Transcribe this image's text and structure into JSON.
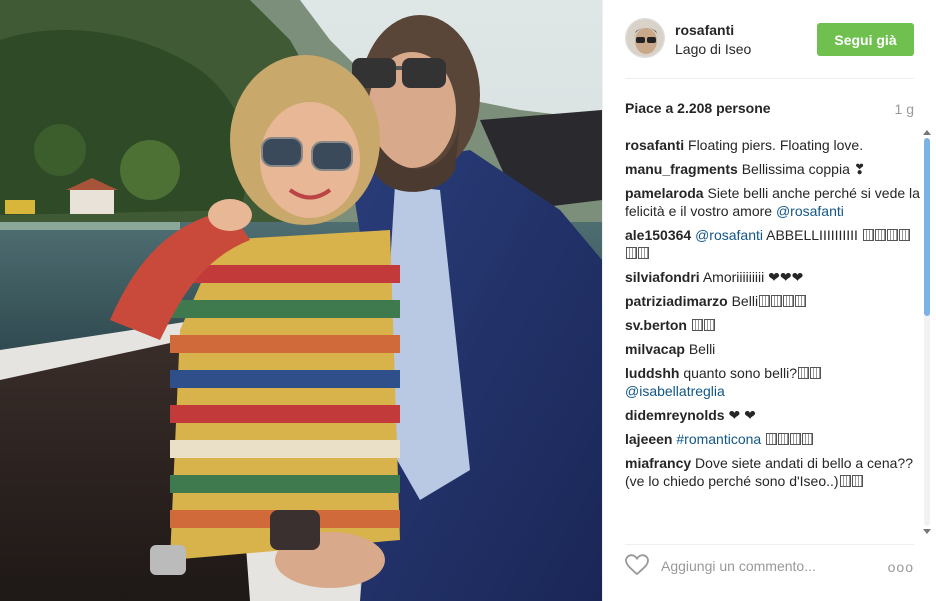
{
  "post": {
    "username": "rosafanti",
    "location": "Lago di Iseo",
    "follow_label": "Segui già",
    "likes_text": "Piace a 2.208 persone",
    "time_ago": "1 g"
  },
  "comments": [
    {
      "user": "rosafanti",
      "text": "Floating piers. Floating love."
    },
    {
      "user": "manu_fragments",
      "text": "Bellissima coppia ❣"
    },
    {
      "user": "pamelaroda",
      "text": "Siete belli anche perché si vede la felicità e il vostro amore",
      "mention": "@rosafanti"
    },
    {
      "user": "ale150364",
      "mention": "@rosafanti",
      "text": "ABBELLIIIIIIIIII"
    },
    {
      "user": "silviafondri",
      "text": "Amoriiiiiiiii ❤❤❤"
    },
    {
      "user": "patriziadimarzo",
      "text": "Belli"
    },
    {
      "user": "sv.berton",
      "text": ""
    },
    {
      "user": "milvacap",
      "text": "Belli"
    },
    {
      "user": "luddshh",
      "text": "quanto sono belli?",
      "mention": "@isabellatreglia"
    },
    {
      "user": "didemreynolds",
      "text": "❤ ❤"
    },
    {
      "user": "lajeeen",
      "mention": "#romanticona",
      "text": ""
    },
    {
      "user": "miafrancy",
      "text": "Dove siete andati di bello a cena?? (ve lo chiedo perché sono d'Iseo..)"
    }
  ],
  "footer": {
    "add_comment_placeholder": "Aggiungi un commento...",
    "more_label": "ooo"
  },
  "icons": [
    "heart-icon",
    "more-options-icon"
  ],
  "colors": {
    "follow_button": "#70c050",
    "mention": "#125688",
    "muted": "#999999"
  }
}
